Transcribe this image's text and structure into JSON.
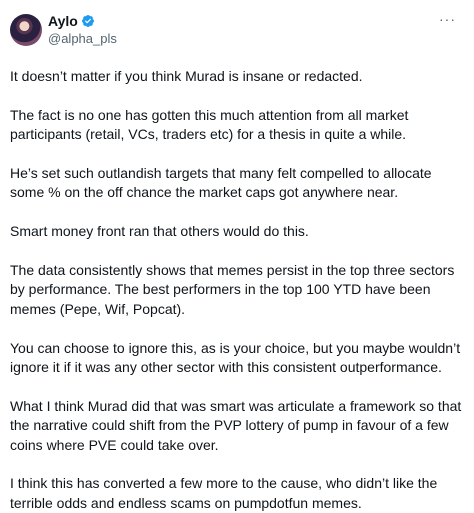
{
  "author": {
    "display_name": "Aylo",
    "handle": "@alpha_pls",
    "verified": true,
    "avatar_icon": "avatar-image"
  },
  "menu": {
    "icon": "more-icon",
    "glyph": "···"
  },
  "tweet": {
    "paragraphs": [
      "It doesn’t matter if you think Murad is insane or redacted.",
      "The fact is no one has gotten this much attention from all market participants (retail, VCs, traders etc) for a thesis in quite a while.",
      "He’s set such outlandish targets that many felt compelled to allocate some % on the off chance the market caps got anywhere near.",
      "Smart money front ran that others would do this.",
      "The data consistently shows that memes persist in the top three sectors by performance. The best performers in the top 100 YTD have been memes (Pepe, Wif, Popcat).",
      "You can choose to ignore this, as is your choice, but you maybe wouldn’t ignore it if it was any other sector with this consistent outperformance.",
      "What I think Murad did that was smart was articulate a framework so that the narrative could shift from the PVP lottery of pump in favour of a few coins where PVE could take over.",
      "I think this has converted a few more to the cause, who didn’t like the terrible odds and endless scams on pumpdotfun memes."
    ]
  },
  "colors": {
    "verified_badge": "#1d9bf0",
    "text": "#0f1419",
    "secondary_text": "#536471"
  }
}
